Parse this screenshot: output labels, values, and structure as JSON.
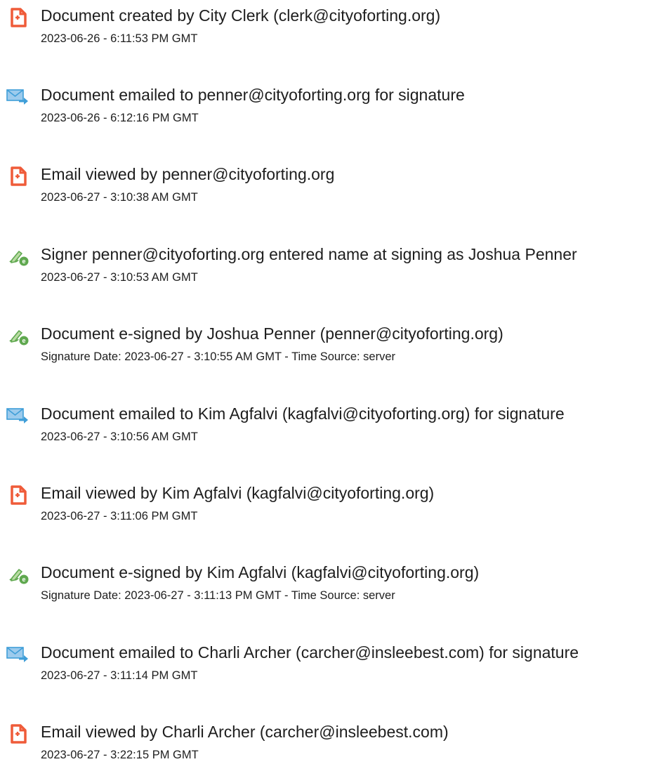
{
  "entries": [
    {
      "icon": "document-created-icon",
      "title": "Document created by City Clerk (clerk@cityoforting.org)",
      "date": "2023-06-26 - 6:11:53 PM GMT"
    },
    {
      "icon": "email-sent-icon",
      "title": "Document emailed to penner@cityoforting.org for signature",
      "date": "2023-06-26 - 6:12:16 PM GMT"
    },
    {
      "icon": "email-viewed-icon",
      "title": "Email viewed by penner@cityoforting.org",
      "date": "2023-06-27 - 3:10:38 AM GMT"
    },
    {
      "icon": "e-sign-icon",
      "title": "Signer penner@cityoforting.org entered name at signing as Joshua Penner",
      "date": "2023-06-27 - 3:10:53 AM GMT"
    },
    {
      "icon": "e-sign-icon",
      "title": "Document e-signed by Joshua Penner (penner@cityoforting.org)",
      "date": "Signature Date: 2023-06-27 - 3:10:55 AM GMT - Time Source: server"
    },
    {
      "icon": "email-sent-icon",
      "title": "Document emailed to Kim Agfalvi (kagfalvi@cityoforting.org) for signature",
      "date": "2023-06-27 - 3:10:56 AM GMT"
    },
    {
      "icon": "email-viewed-icon",
      "title": "Email viewed by Kim Agfalvi (kagfalvi@cityoforting.org)",
      "date": "2023-06-27 - 3:11:06 PM GMT"
    },
    {
      "icon": "e-sign-icon",
      "title": "Document e-signed by Kim Agfalvi (kagfalvi@cityoforting.org)",
      "date": "Signature Date: 2023-06-27 - 3:11:13 PM GMT - Time Source: server"
    },
    {
      "icon": "email-sent-icon",
      "title": "Document emailed to Charli Archer (carcher@insleebest.com) for signature",
      "date": "2023-06-27 - 3:11:14 PM GMT"
    },
    {
      "icon": "email-viewed-icon",
      "title": "Email viewed by Charli Archer (carcher@insleebest.com)",
      "date": "2023-06-27 - 3:22:15 PM GMT"
    }
  ],
  "colors": {
    "doc_icon": "#ef5b39",
    "mail_icon": "#3f9ed8",
    "sign_icon": "#5fa84f",
    "text": "#1e1e1e"
  }
}
